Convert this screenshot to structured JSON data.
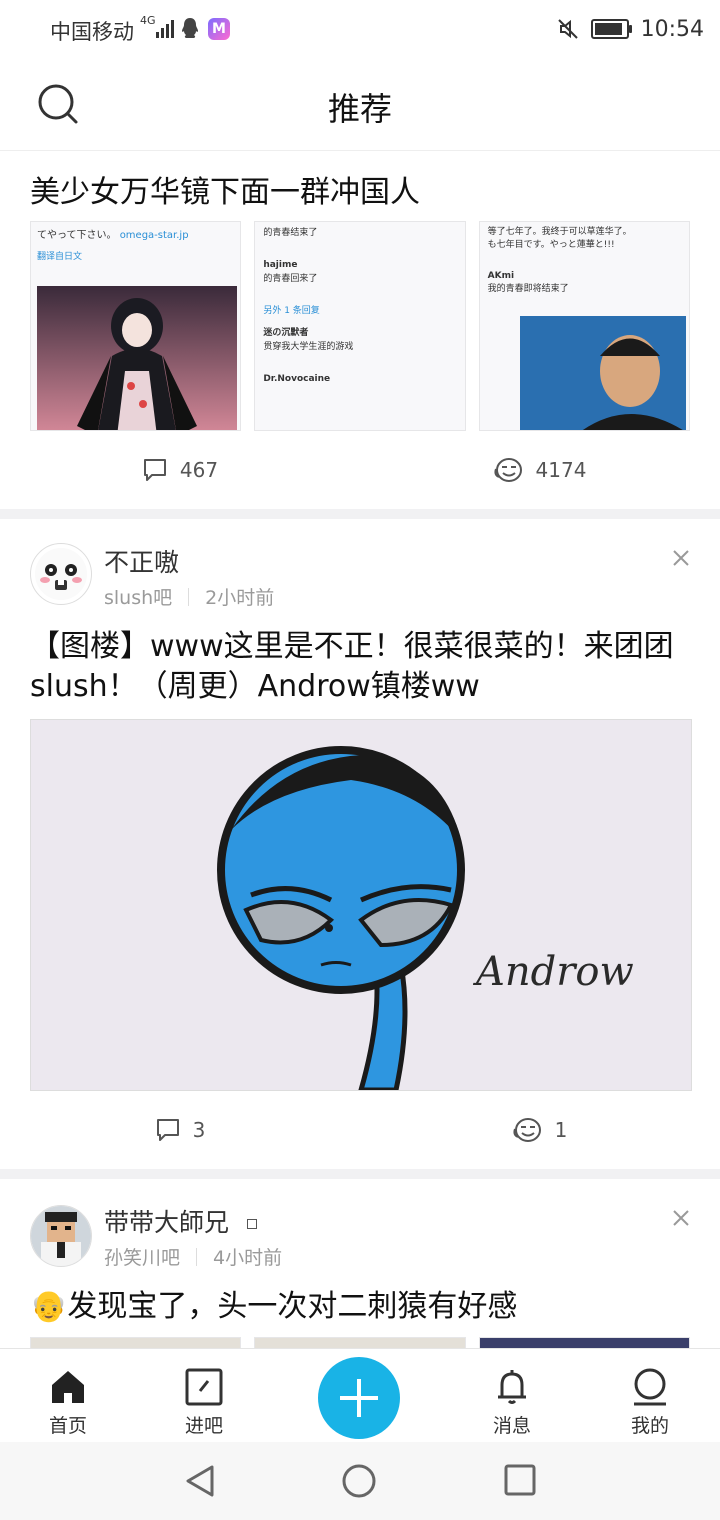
{
  "status_bar": {
    "carrier": "中国移动",
    "network": "4G",
    "time": "10:54"
  },
  "header": {
    "title": "推荐",
    "search_icon": "search-icon"
  },
  "posts": [
    {
      "title": "美少女万华镜下面一群冲国人",
      "comments": "467",
      "likes": "4174",
      "thumb_texts": {
        "t1_line1": "てやって下さい。",
        "t1_link": "omega-star.jp",
        "t1_translate": "翻译自日文",
        "t2_reply": "的青春结束了",
        "t2_user": "hajime",
        "t2_reply2": "的青春回来了",
        "t2_more": "另外 1 条回复",
        "t2_user2": "迷の沉默者",
        "t2_reply3": "贯穿我大学生涯的游戏",
        "t2_user3": "Dr.Novocaine",
        "t3_line1": "等了七年了。我终于可以草莲华了。",
        "t3_line2": "も七年目です。やっと蓮華と!!!",
        "t3_user": "AKmi",
        "t3_reply": "我的青春即将结束了"
      }
    },
    {
      "author": "不正嗷",
      "bar": "slush吧",
      "time": "2小时前",
      "title": "【图楼】www这里是不正！很菜很菜的！来团团slush！（周更）Androw镇楼ww",
      "image_text": "Androw",
      "comments": "3",
      "likes": "1"
    },
    {
      "author": "带带大師兄",
      "bar": "孙笑川吧",
      "time": "4小时前",
      "title_emoji": "👴",
      "title": "发现宝了，头一次对二刺猿有好感"
    }
  ],
  "bottom_nav": {
    "home": "首页",
    "enter_bar": "进吧",
    "messages": "消息",
    "mine": "我的"
  },
  "colors": {
    "accent": "#19b3e6",
    "text": "#222222",
    "meta": "#9a9a9a"
  }
}
